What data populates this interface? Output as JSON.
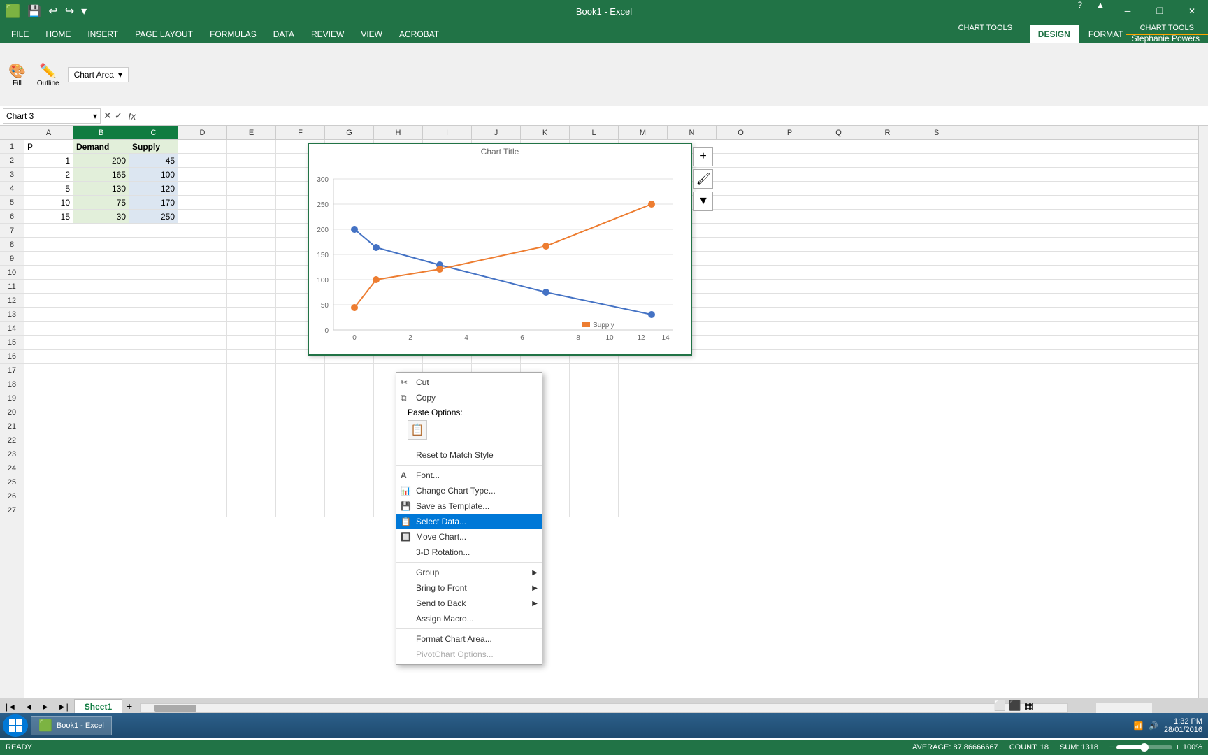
{
  "window": {
    "title": "Book1 - Excel",
    "chart_tools_label": "CHART TOOLS"
  },
  "title_bar": {
    "title": "Book1 - Excel",
    "chart_tools": "CHART TOOLS",
    "minimize": "─",
    "restore": "❐",
    "close": "✕"
  },
  "quick_access": {
    "save": "💾",
    "undo": "↩",
    "redo": "↪"
  },
  "ribbon_tabs": [
    {
      "label": "FILE",
      "active": false
    },
    {
      "label": "HOME",
      "active": false
    },
    {
      "label": "INSERT",
      "active": false
    },
    {
      "label": "PAGE LAYOUT",
      "active": false
    },
    {
      "label": "FORMULAS",
      "active": false
    },
    {
      "label": "DATA",
      "active": false
    },
    {
      "label": "REVIEW",
      "active": false
    },
    {
      "label": "VIEW",
      "active": false
    },
    {
      "label": "ACROBAT",
      "active": false
    },
    {
      "label": "DESIGN",
      "active": true
    },
    {
      "label": "FORMAT",
      "active": false
    }
  ],
  "formula_bar": {
    "name_box": "Chart 3",
    "cancel": "✕",
    "confirm": "✓",
    "fx": "fx"
  },
  "columns": [
    "A",
    "B",
    "C",
    "D",
    "E",
    "F",
    "G",
    "H",
    "I",
    "J",
    "K",
    "L",
    "M",
    "N",
    "O",
    "P",
    "Q",
    "R",
    "S"
  ],
  "rows": [
    {
      "num": 1,
      "cells": [
        "P",
        "Demand",
        "Supply",
        "",
        "",
        "",
        "",
        "",
        "",
        "",
        "",
        "",
        "",
        "",
        "",
        "",
        "",
        "",
        ""
      ]
    },
    {
      "num": 2,
      "cells": [
        "1",
        "200",
        "45",
        "",
        "",
        "",
        "",
        "",
        "",
        "",
        "",
        "",
        "",
        "",
        "",
        "",
        "",
        "",
        ""
      ]
    },
    {
      "num": 3,
      "cells": [
        "2",
        "165",
        "100",
        "",
        "",
        "",
        "",
        "",
        "",
        "",
        "",
        "",
        "",
        "",
        "",
        "",
        "",
        "",
        ""
      ]
    },
    {
      "num": 4,
      "cells": [
        "5",
        "130",
        "120",
        "",
        "",
        "",
        "",
        "",
        "",
        "",
        "",
        "",
        "",
        "",
        "",
        "",
        "",
        "",
        ""
      ]
    },
    {
      "num": 5,
      "cells": [
        "10",
        "75",
        "170",
        "",
        "",
        "",
        "",
        "",
        "",
        "",
        "",
        "",
        "",
        "",
        "",
        "",
        "",
        "",
        ""
      ]
    },
    {
      "num": 6,
      "cells": [
        "15",
        "30",
        "250",
        "",
        "",
        "",
        "",
        "",
        "",
        "",
        "",
        "",
        "",
        "",
        "",
        "",
        "",
        "",
        ""
      ]
    },
    {
      "num": 7,
      "cells": [
        "",
        "",
        "",
        "",
        "",
        "",
        "",
        "",
        "",
        "",
        "",
        "",
        "",
        "",
        "",
        "",
        "",
        "",
        ""
      ]
    },
    {
      "num": 8,
      "cells": [
        "",
        "",
        "",
        "",
        "",
        "",
        "",
        "",
        "",
        "",
        "",
        "",
        "",
        "",
        "",
        "",
        "",
        "",
        ""
      ]
    },
    {
      "num": 9,
      "cells": [
        "",
        "",
        "",
        "",
        "",
        "",
        "",
        "",
        "",
        "",
        "",
        "",
        "",
        "",
        "",
        "",
        "",
        "",
        ""
      ]
    },
    {
      "num": 10,
      "cells": [
        "",
        "",
        "",
        "",
        "",
        "",
        "",
        "",
        "",
        "",
        "",
        "",
        "",
        "",
        "",
        "",
        "",
        "",
        ""
      ]
    },
    {
      "num": 11,
      "cells": [
        "",
        "",
        "",
        "",
        "",
        "",
        "",
        "",
        "",
        "",
        "",
        "",
        "",
        "",
        "",
        "",
        "",
        "",
        ""
      ]
    },
    {
      "num": 12,
      "cells": [
        "",
        "",
        "",
        "",
        "",
        "",
        "",
        "",
        "",
        "",
        "",
        "",
        "",
        "",
        "",
        "",
        "",
        "",
        ""
      ]
    },
    {
      "num": 13,
      "cells": [
        "",
        "",
        "",
        "",
        "",
        "",
        "",
        "",
        "",
        "",
        "",
        "",
        "",
        "",
        "",
        "",
        "",
        "",
        ""
      ]
    },
    {
      "num": 14,
      "cells": [
        "",
        "",
        "",
        "",
        "",
        "",
        "",
        "",
        "",
        "",
        "",
        "",
        "",
        "",
        "",
        "",
        "",
        "",
        ""
      ]
    },
    {
      "num": 15,
      "cells": [
        "",
        "",
        "",
        "",
        "",
        "",
        "",
        "",
        "",
        "",
        "",
        "",
        "",
        "",
        "",
        "",
        "",
        "",
        ""
      ]
    },
    {
      "num": 16,
      "cells": [
        "",
        "",
        "",
        "",
        "",
        "",
        "",
        "",
        "",
        "",
        "",
        "",
        "",
        "",
        "",
        "",
        "",
        "",
        ""
      ]
    },
    {
      "num": 17,
      "cells": [
        "",
        "",
        "",
        "",
        "",
        "",
        "",
        "",
        "",
        "",
        "",
        "",
        "",
        "",
        "",
        "",
        "",
        "",
        ""
      ]
    },
    {
      "num": 18,
      "cells": [
        "",
        "",
        "",
        "",
        "",
        "",
        "",
        "",
        "",
        "",
        "",
        "",
        "",
        "",
        "",
        "",
        "",
        "",
        ""
      ]
    },
    {
      "num": 19,
      "cells": [
        "",
        "",
        "",
        "",
        "",
        "",
        "",
        "",
        "",
        "",
        "",
        "",
        "",
        "",
        "",
        "",
        "",
        "",
        ""
      ]
    },
    {
      "num": 20,
      "cells": [
        "",
        "",
        "",
        "",
        "",
        "",
        "",
        "",
        "",
        "",
        "",
        "",
        "",
        "",
        "",
        "",
        "",
        "",
        ""
      ]
    },
    {
      "num": 21,
      "cells": [
        "",
        "",
        "",
        "",
        "",
        "",
        "",
        "",
        "",
        "",
        "",
        "",
        "",
        "",
        "",
        "",
        "",
        "",
        ""
      ]
    },
    {
      "num": 22,
      "cells": [
        "",
        "",
        "",
        "",
        "",
        "",
        "",
        "",
        "",
        "",
        "",
        "",
        "",
        "",
        "",
        "",
        "",
        "",
        ""
      ]
    },
    {
      "num": 23,
      "cells": [
        "",
        "",
        "",
        "",
        "",
        "",
        "",
        "",
        "",
        "",
        "",
        "",
        "",
        "",
        "",
        "",
        "",
        "",
        ""
      ]
    },
    {
      "num": 24,
      "cells": [
        "",
        "",
        "",
        "",
        "",
        "",
        "",
        "",
        "",
        "",
        "",
        "",
        "",
        "",
        "",
        "",
        "",
        "",
        ""
      ]
    },
    {
      "num": 25,
      "cells": [
        "",
        "",
        "",
        "",
        "",
        "",
        "",
        "",
        "",
        "",
        "",
        "",
        "",
        "",
        "",
        "",
        "",
        "",
        ""
      ]
    },
    {
      "num": 26,
      "cells": [
        "",
        "",
        "",
        "",
        "",
        "",
        "",
        "",
        "",
        "",
        "",
        "",
        "",
        "",
        "",
        "",
        "",
        "",
        ""
      ]
    },
    {
      "num": 27,
      "cells": [
        "",
        "",
        "",
        "",
        "",
        "",
        "",
        "",
        "",
        "",
        "",
        "",
        "",
        "",
        "",
        "",
        "",
        "",
        ""
      ]
    }
  ],
  "chart_toolbar": {
    "fill_label": "Fill",
    "outline_label": "Outline",
    "chart_area_label": "Chart Area"
  },
  "context_menu": {
    "items": [
      {
        "id": "cut",
        "label": "Cut",
        "icon": "✂",
        "has_arrow": false,
        "separator_before": false,
        "disabled": false
      },
      {
        "id": "copy",
        "label": "Copy",
        "icon": "⧉",
        "has_arrow": false,
        "separator_before": false,
        "disabled": false
      },
      {
        "id": "paste-options",
        "label": "Paste Options:",
        "icon": "",
        "has_arrow": false,
        "separator_before": false,
        "is_section": true,
        "disabled": false
      },
      {
        "id": "paste-icon",
        "label": "",
        "icon": "📋",
        "has_arrow": false,
        "separator_before": false,
        "is_paste_btn": true,
        "disabled": false
      },
      {
        "id": "reset-style",
        "label": "Reset to Match Style",
        "icon": "",
        "has_arrow": false,
        "separator_before": true,
        "disabled": false
      },
      {
        "id": "font",
        "label": "Font...",
        "icon": "A",
        "has_arrow": false,
        "separator_before": false,
        "disabled": false
      },
      {
        "id": "change-chart-type",
        "label": "Change Chart Type...",
        "icon": "📊",
        "has_arrow": false,
        "separator_before": false,
        "disabled": false
      },
      {
        "id": "save-template",
        "label": "Save as Template...",
        "icon": "💾",
        "has_arrow": false,
        "separator_before": false,
        "disabled": false
      },
      {
        "id": "select-data",
        "label": "Select Data...",
        "icon": "📋",
        "has_arrow": false,
        "separator_before": false,
        "highlighted": true,
        "disabled": false
      },
      {
        "id": "move-chart",
        "label": "Move Chart...",
        "icon": "🔲",
        "has_arrow": false,
        "separator_before": false,
        "disabled": false
      },
      {
        "id": "3d-rotation",
        "label": "3-D Rotation...",
        "icon": "🔄",
        "has_arrow": false,
        "separator_before": false,
        "disabled": false
      },
      {
        "id": "group",
        "label": "Group",
        "icon": "",
        "has_arrow": true,
        "separator_before": true,
        "disabled": false
      },
      {
        "id": "bring-to-front",
        "label": "Bring to Front",
        "icon": "",
        "has_arrow": true,
        "separator_before": false,
        "disabled": false
      },
      {
        "id": "send-to-back",
        "label": "Send to Back",
        "icon": "",
        "has_arrow": true,
        "separator_before": false,
        "disabled": false
      },
      {
        "id": "assign-macro",
        "label": "Assign Macro...",
        "icon": "",
        "has_arrow": false,
        "separator_before": false,
        "disabled": false
      },
      {
        "id": "format-chart-area",
        "label": "Format Chart Area...",
        "icon": "",
        "has_arrow": false,
        "separator_before": true,
        "disabled": false
      },
      {
        "id": "pivotchart-options",
        "label": "PivotChart Options...",
        "icon": "",
        "has_arrow": false,
        "separator_before": false,
        "disabled": true
      }
    ]
  },
  "status_bar": {
    "ready": "READY",
    "average": "AVERAGE: 87.86666667",
    "count": "COUNT: 18",
    "sum": "SUM: 1318",
    "zoom": "100%"
  },
  "sheet_tabs": [
    {
      "label": "Sheet1",
      "active": true
    }
  ],
  "taskbar": {
    "time": "1:32 PM",
    "date": "28/01/2016"
  },
  "user": "Stephanie Powers"
}
